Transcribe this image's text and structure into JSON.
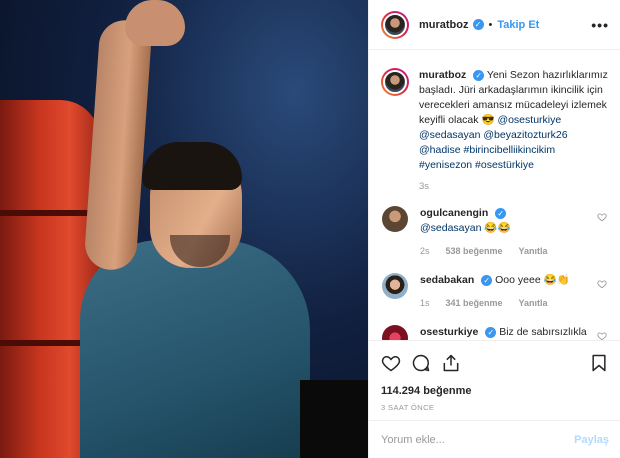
{
  "post": {
    "username": "muratboz",
    "follow_label": "Takip Et",
    "more_label": "•••",
    "verified_mark": "✓"
  },
  "caption": {
    "username": "muratboz",
    "text": "Yeni Sezon hazırlıklarımız başladı. Jüri arkadaşlarımın ikincilik için verecekleri amansız mücadeleyi izlemek keyifli olacak 😎",
    "tags": "@osesturkiye @sedasayan @beyazitozturk26 @hadise #birincibelliikincikim #yenisezon #osestürkiye",
    "time": "3s"
  },
  "comments": [
    {
      "username": "ogulcanengin",
      "text": "@sedasayan 😂😂",
      "time": "2s",
      "likes": "538 beğenme",
      "reply": "Yanıtla",
      "avatar_color": "#5a4632"
    },
    {
      "username": "sedabakan",
      "text": "Ooo yeee 😂👏",
      "time": "1s",
      "likes": "341 beğenme",
      "reply": "Yanıtla",
      "avatar_color": "#8fb0c8"
    },
    {
      "username": "osesturkiye",
      "text": "Biz de sabırsızlıkla",
      "avatar_color": "#7a1020"
    }
  ],
  "actions": {
    "likes": "114.294 beğenme",
    "time_ago": "3 SAAT ÖNCE",
    "comment_placeholder": "Yorum ekle...",
    "post_label": "Paylaş"
  },
  "icons": [
    "heart-icon",
    "comment-icon",
    "share-icon",
    "bookmark-icon",
    "verified-icon",
    "more-icon"
  ]
}
